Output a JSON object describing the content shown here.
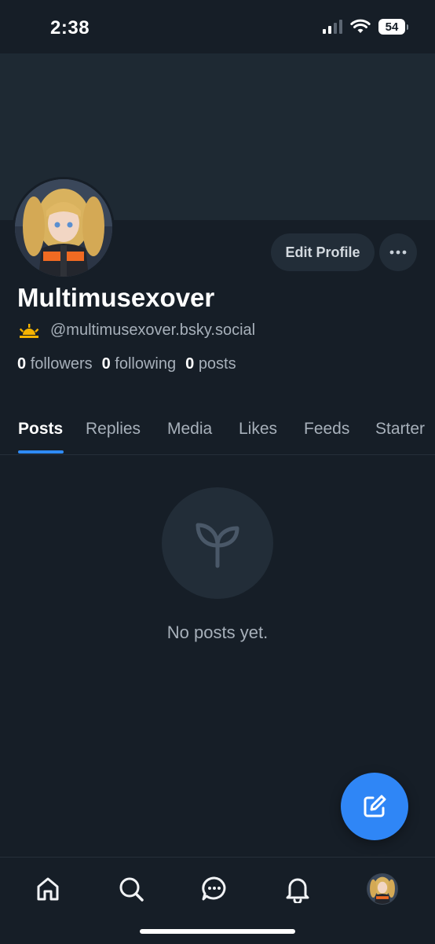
{
  "status_bar": {
    "time": "2:38",
    "battery": "54"
  },
  "profile": {
    "display_name": "Multimusexover",
    "handle": "@multimusexover.bsky.social",
    "handle_icon": "sunrise-emoji",
    "edit_label": "Edit Profile",
    "stats": {
      "followers_count": "0",
      "followers_label": "followers",
      "following_count": "0",
      "following_label": "following",
      "posts_count": "0",
      "posts_label": "posts"
    }
  },
  "tabs": [
    "Posts",
    "Replies",
    "Media",
    "Likes",
    "Feeds",
    "Starter"
  ],
  "active_tab": "Posts",
  "empty_state": {
    "icon": "sprout-icon",
    "text": "No posts yet."
  },
  "fab": {
    "icon": "compose-icon"
  },
  "bottom_nav": [
    "home-icon",
    "search-icon",
    "chat-icon",
    "bell-icon",
    "avatar"
  ],
  "colors": {
    "background": "#161e27",
    "banner": "#1e2933",
    "accent": "#2f86f6",
    "muted_text": "#a7b0ba"
  }
}
